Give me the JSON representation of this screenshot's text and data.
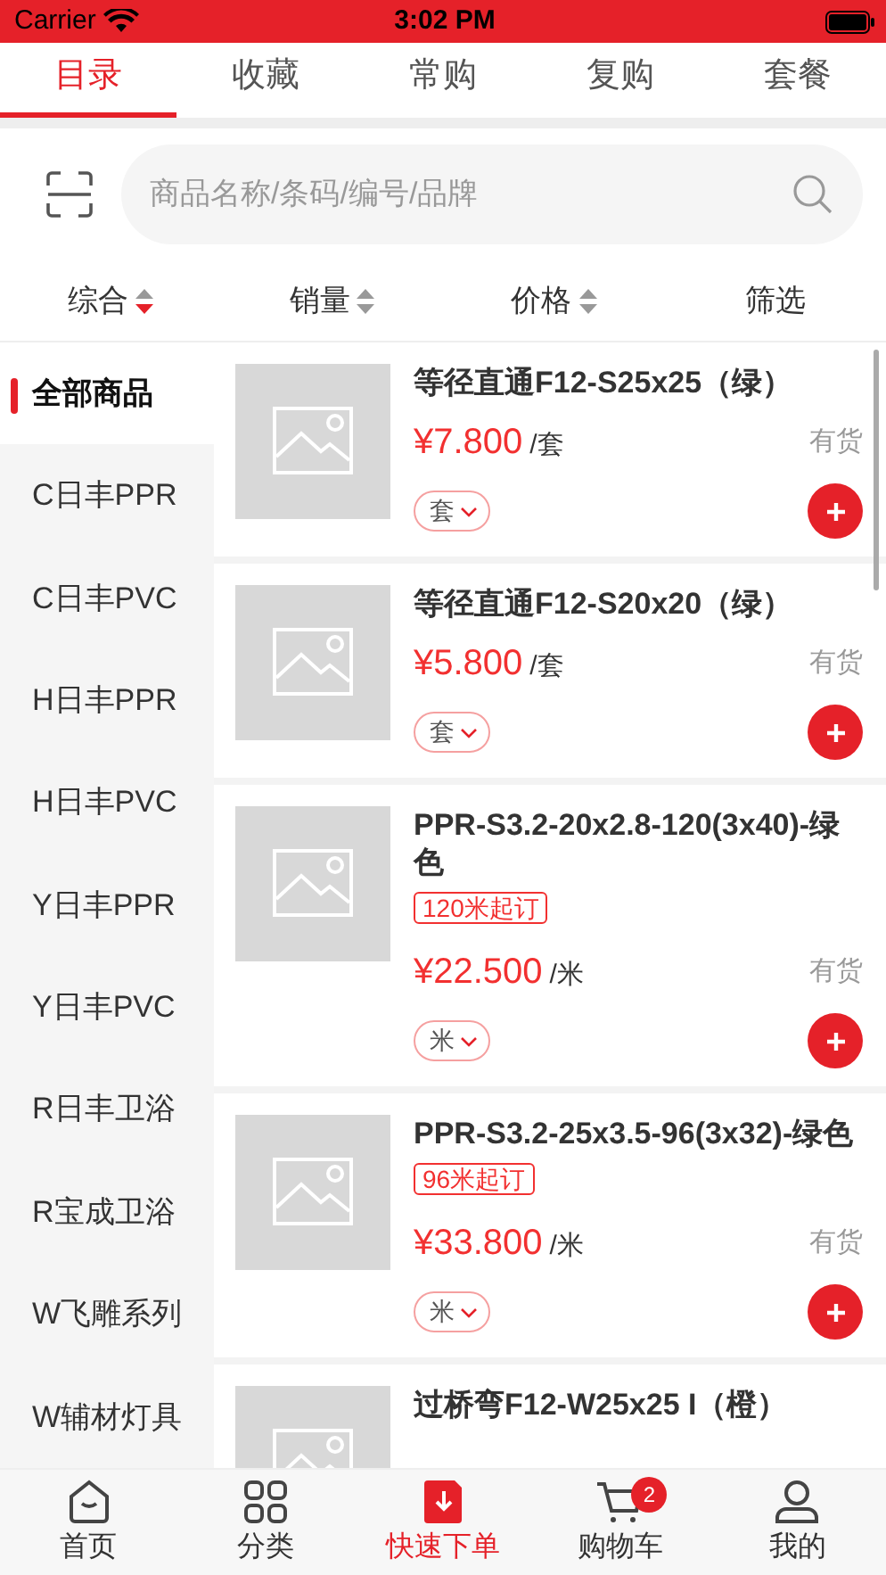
{
  "status_bar": {
    "carrier": "Carrier",
    "time": "3:02 PM"
  },
  "tabs": [
    {
      "label": "目录",
      "selected": true
    },
    {
      "label": "收藏",
      "selected": false
    },
    {
      "label": "常购",
      "selected": false
    },
    {
      "label": "复购",
      "selected": false
    },
    {
      "label": "套餐",
      "selected": false
    }
  ],
  "search": {
    "placeholder": "商品名称/条码/编号/品牌"
  },
  "sort_options": [
    {
      "label": "综合",
      "kind": "sort",
      "selected": true
    },
    {
      "label": "销量",
      "kind": "sort",
      "selected": false
    },
    {
      "label": "价格",
      "kind": "sort",
      "selected": false
    },
    {
      "label": "筛选",
      "kind": "filter",
      "selected": false
    }
  ],
  "categories": [
    {
      "label": "全部商品",
      "selected": true
    },
    {
      "label": "C日丰PPR",
      "selected": false
    },
    {
      "label": "C日丰PVC",
      "selected": false
    },
    {
      "label": "H日丰PPR",
      "selected": false
    },
    {
      "label": "H日丰PVC",
      "selected": false
    },
    {
      "label": "Y日丰PPR",
      "selected": false
    },
    {
      "label": "Y日丰PVC",
      "selected": false
    },
    {
      "label": "R日丰卫浴",
      "selected": false
    },
    {
      "label": "R宝成卫浴",
      "selected": false
    },
    {
      "label": "W飞雕系列",
      "selected": false
    },
    {
      "label": "W辅材灯具",
      "selected": false
    }
  ],
  "products": [
    {
      "name": "等径直通F12-S25x25（绿）",
      "price": "¥7.800",
      "unit": "/套",
      "stock": "有货",
      "unit_selector": "套"
    },
    {
      "name": "等径直通F12-S20x20（绿）",
      "price": "¥5.800",
      "unit": "/套",
      "stock": "有货",
      "unit_selector": "套"
    },
    {
      "name": "PPR-S3.2-20x2.8-120(3x40)-绿色",
      "min_order": "120米起订",
      "price": "¥22.500",
      "unit": "/米",
      "stock": "有货",
      "unit_selector": "米"
    },
    {
      "name": "PPR-S3.2-25x3.5-96(3x32)-绿色",
      "min_order": "96米起订",
      "price": "¥33.800",
      "unit": "/米",
      "stock": "有货",
      "unit_selector": "米"
    },
    {
      "name": "过桥弯F12-W25x25 I（橙）"
    }
  ],
  "bottom_nav": [
    {
      "label": "首页",
      "selected": false
    },
    {
      "label": "分类",
      "selected": false
    },
    {
      "label": "快速下单",
      "selected": true
    },
    {
      "label": "购物车",
      "selected": false,
      "badge": "2"
    },
    {
      "label": "我的",
      "selected": false
    }
  ]
}
